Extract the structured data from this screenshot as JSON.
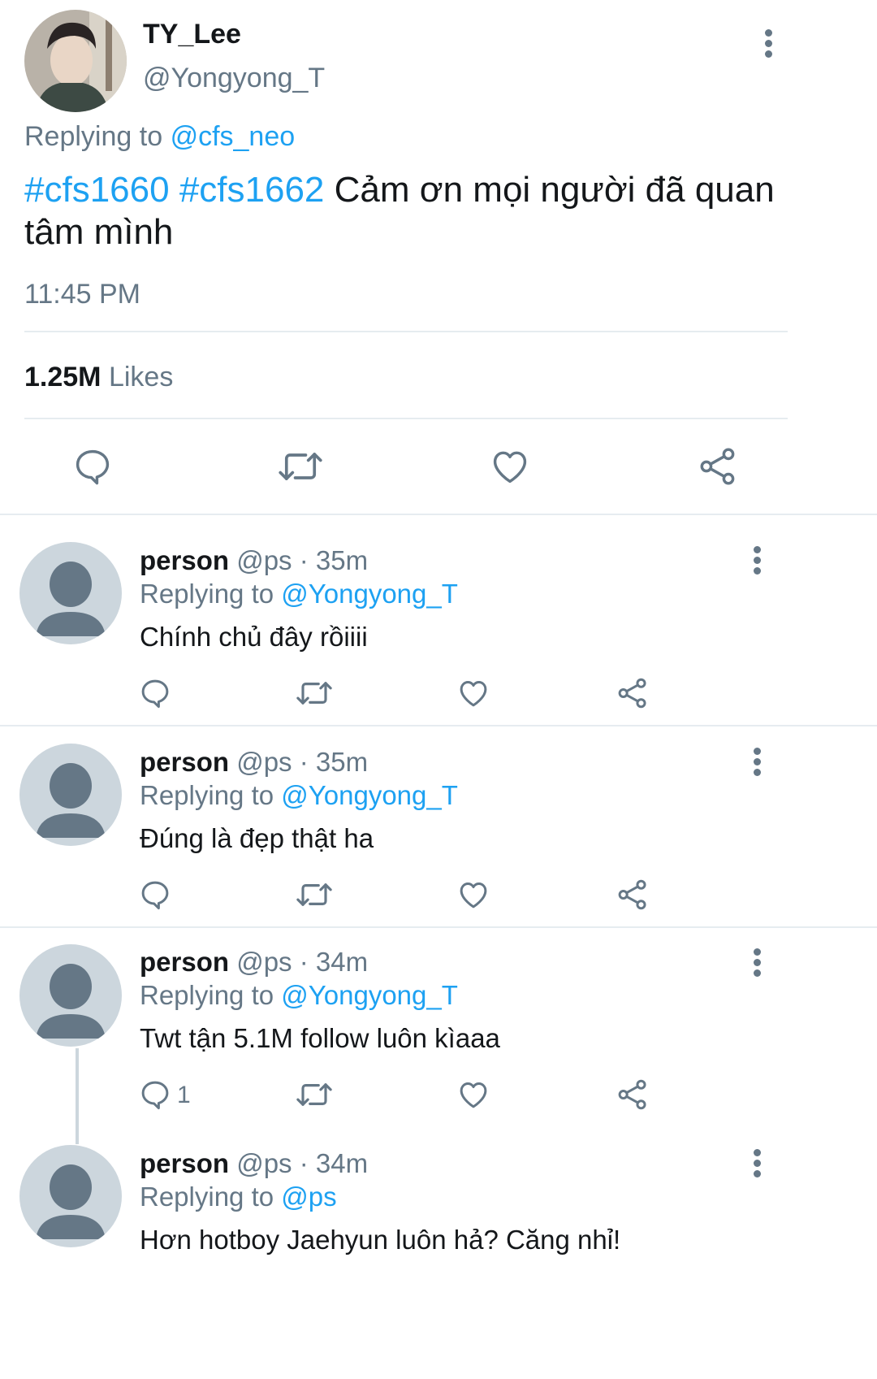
{
  "tweet": {
    "display_name": "TY_Lee",
    "handle": "@Yongyong_T",
    "replying_prefix": "Replying to",
    "replying_to": "@cfs_neo",
    "hashtag_1": "#cfs1660",
    "hashtag_2": "#cfs1662",
    "text": "Cảm ơn mọi người đã quan tâm mình",
    "time": "11:45 PM",
    "likes_count": "1.25M",
    "likes_label": "Likes"
  },
  "replies": [
    {
      "name": "person",
      "handle": "@ps",
      "dot": "·",
      "time": "35m",
      "replying_prefix": "Replying to",
      "replying_to": "@Yongyong_T",
      "text": "Chính chủ đây rồiiii",
      "reply_count": ""
    },
    {
      "name": "person",
      "handle": "@ps",
      "dot": "·",
      "time": "35m",
      "replying_prefix": "Replying to",
      "replying_to": "@Yongyong_T",
      "text": "Đúng là đẹp thật ha",
      "reply_count": ""
    },
    {
      "name": "person",
      "handle": "@ps",
      "dot": "·",
      "time": "34m",
      "replying_prefix": "Replying to",
      "replying_to": "@Yongyong_T",
      "text": "Twt tận 5.1M follow luôn kìaaa",
      "reply_count": "1"
    },
    {
      "name": "person",
      "handle": "@ps",
      "dot": "·",
      "time": "34m",
      "replying_prefix": "Replying to",
      "replying_to": "@ps",
      "text": "Hơn hotboy Jaehyun luôn hả? Căng nhỉ!",
      "reply_count": ""
    }
  ],
  "icons": {
    "reply": "reply-icon",
    "retweet": "retweet-icon",
    "like": "heart-icon",
    "share": "share-icon",
    "more": "more-vertical-icon"
  },
  "colors": {
    "link": "#1da1f2",
    "secondary": "#657786",
    "divider": "#e6ecf0",
    "avatar_placeholder": "#ccd6dd"
  }
}
